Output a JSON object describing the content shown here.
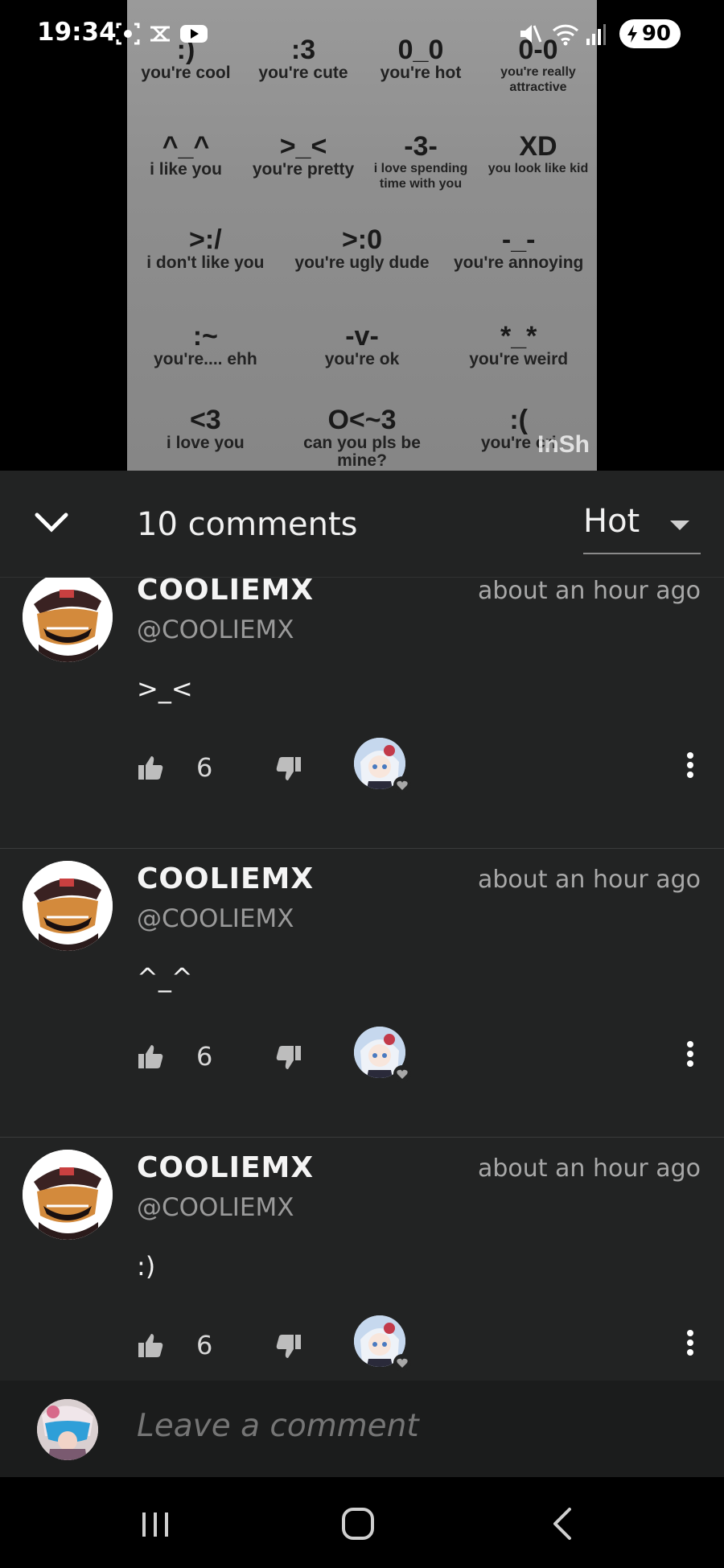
{
  "status_bar": {
    "time": "19:34",
    "battery": "90",
    "icons_left": [
      "screen-record-icon",
      "capcut-icon",
      "youtube-icon"
    ],
    "icons_right": [
      "mute-icon",
      "wifi-icon",
      "signal-icon",
      "battery-icon"
    ]
  },
  "video": {
    "rows": [
      [
        {
          "face": ":)",
          "text": "you're cool"
        },
        {
          "face": ":3",
          "text": "you're cute"
        },
        {
          "face": "0_0",
          "text": "you're hot"
        },
        {
          "face": "0-0",
          "text": "you're really attractive"
        }
      ],
      [
        {
          "face": "^_^",
          "text": "i like you"
        },
        {
          "face": ">_<",
          "text": "you're pretty"
        },
        {
          "face": "-3-",
          "text": "i love spending time with you"
        },
        {
          "face": "XD",
          "text": "you look like kid"
        }
      ],
      [
        {
          "face": ">:/",
          "text": "i don't like you"
        },
        {
          "face": ">:0",
          "text": "you're ugly dude"
        },
        {
          "face": "-_-",
          "text": "you're annoying"
        }
      ],
      [
        {
          "face": ":~",
          "text": "you're.... ehh"
        },
        {
          "face": "-v-",
          "text": "you're ok"
        },
        {
          "face": "*_*",
          "text": "you're weird"
        }
      ],
      [
        {
          "face": "<3",
          "text": "i love you"
        },
        {
          "face": "O<~3",
          "text": "can you pls be mine?"
        },
        {
          "face": ":(",
          "text": "you're cri"
        }
      ]
    ],
    "watermark": "InSh"
  },
  "comments_header": {
    "count_label": "10 comments",
    "sort_value": "Hot"
  },
  "comments": [
    {
      "author": "COOLIEMX",
      "handle": "@COOLIEMX",
      "time": "about an hour ago",
      "text": ">_<",
      "likes": "6"
    },
    {
      "author": "COOLIEMX",
      "handle": "@COOLIEMX",
      "time": "about an hour ago",
      "text": "^_^",
      "likes": "6"
    },
    {
      "author": "COOLIEMX",
      "handle": "@COOLIEMX",
      "time": "about an hour ago",
      "text": ":)",
      "likes": "6"
    }
  ],
  "leave_comment": {
    "placeholder": "Leave a comment"
  },
  "nav": {
    "buttons": [
      "recent-apps-icon",
      "home-icon",
      "back-icon"
    ]
  },
  "colors": {
    "panel_bg": "#222323",
    "input_bar_bg": "#1b1c1c",
    "text_primary": "#f1f1f1",
    "text_secondary": "#9a9a9a"
  }
}
